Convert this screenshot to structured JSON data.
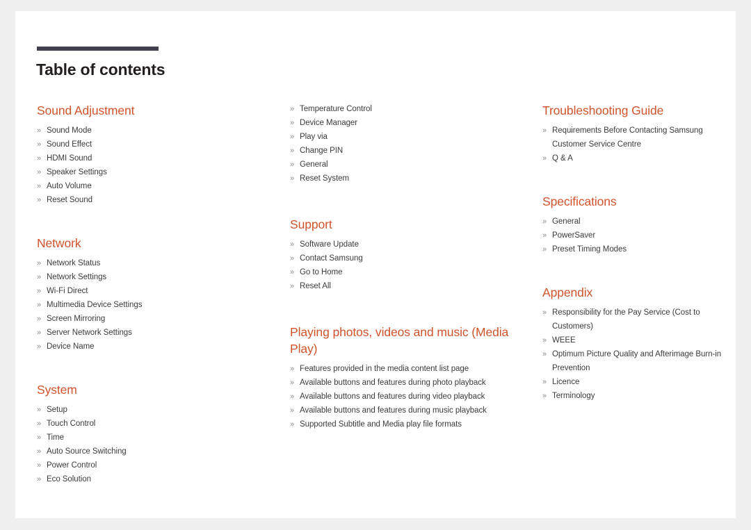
{
  "document": {
    "title": "Table of contents",
    "accent_color": "#d1532c",
    "rule_color": "#40404c",
    "text_color": "#3b3b3b",
    "marker": "»",
    "page_background": "#ffffff",
    "canvas_background": "#efefef"
  },
  "columns": [
    {
      "id": "column-left",
      "sections": [
        {
          "heading": "Sound Adjustment",
          "items": [
            "Sound Mode",
            "Sound Effect",
            "HDMI Sound",
            "Speaker Settings",
            "Auto Volume",
            "Reset Sound"
          ]
        },
        {
          "heading": "Network",
          "items": [
            "Network Status",
            "Network Settings",
            "Wi-Fi Direct",
            "Multimedia Device Settings",
            "Screen Mirroring",
            "Server Network Settings",
            "Device Name"
          ]
        },
        {
          "heading": "System",
          "items": [
            "Setup",
            "Touch Control",
            "Time",
            "Auto Source Switching",
            "Power Control",
            "Eco Solution"
          ]
        }
      ]
    },
    {
      "id": "column-middle",
      "sections": [
        {
          "heading": "",
          "items": [
            "Temperature Control",
            "Device Manager",
            "Play via",
            "Change PIN",
            "General",
            "Reset System"
          ]
        },
        {
          "heading": "Support",
          "items": [
            "Software Update",
            "Contact Samsung",
            "Go to Home",
            "Reset All"
          ]
        },
        {
          "heading": "Playing photos, videos and music (Media Play)",
          "items": [
            "Features provided in the media content list page",
            "Available buttons and features during photo playback",
            "Available buttons and features during video playback",
            "Available buttons and features during music playback",
            "Supported Subtitle and Media play file formats"
          ]
        }
      ]
    },
    {
      "id": "column-right",
      "sections": [
        {
          "heading": "Troubleshooting Guide",
          "items": [
            "Requirements Before Contacting Samsung Customer Service Centre",
            "Q & A"
          ]
        },
        {
          "heading": "Specifications",
          "items": [
            "General",
            "PowerSaver",
            "Preset Timing Modes"
          ]
        },
        {
          "heading": "Appendix",
          "items": [
            "Responsibility for the Pay Service (Cost to Customers)",
            "WEEE",
            "Optimum Picture Quality and Afterimage Burn-in Prevention",
            "Licence",
            "Terminology"
          ]
        }
      ]
    }
  ]
}
